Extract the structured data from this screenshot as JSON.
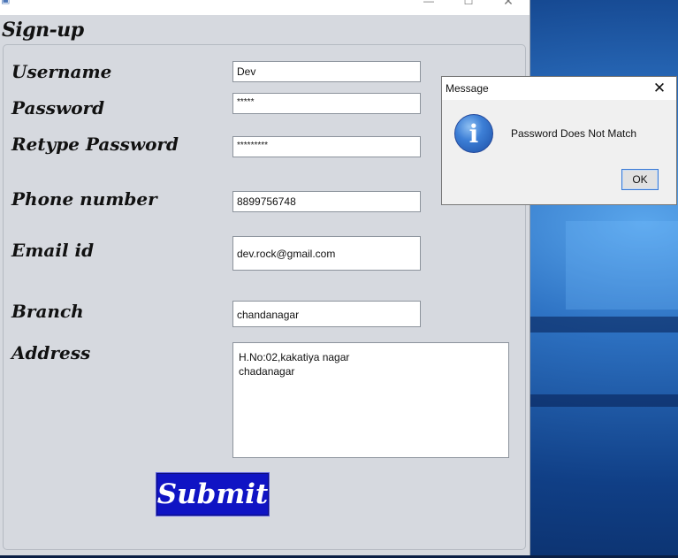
{
  "window": {
    "title_bar": {
      "minimize": "—",
      "maximize": "☐",
      "close": "✕"
    },
    "heading": "Sign-up"
  },
  "form": {
    "username": {
      "label": "Username",
      "value": "Dev"
    },
    "password": {
      "label": "Password",
      "value": "*****"
    },
    "retype_password": {
      "label": "Retype Password",
      "value": "*********"
    },
    "phone": {
      "label": "Phone number",
      "value": "8899756748"
    },
    "email": {
      "label": "Email id",
      "value": "dev.rock@gmail.com"
    },
    "branch": {
      "label": "Branch",
      "value": "chandanagar"
    },
    "address": {
      "label": "Address",
      "value": "H.No:02,kakatiya nagar\nchadanagar"
    },
    "submit_label": "Submit"
  },
  "dialog": {
    "title": "Message",
    "close": "✕",
    "icon": "info-icon",
    "icon_glyph": "i",
    "message": "Password Does Not Match",
    "ok_label": "OK"
  },
  "colors": {
    "submit_bg": "#1014c4",
    "frame_bg": "#d6d9df",
    "dialog_bg": "#f0f0f0"
  }
}
